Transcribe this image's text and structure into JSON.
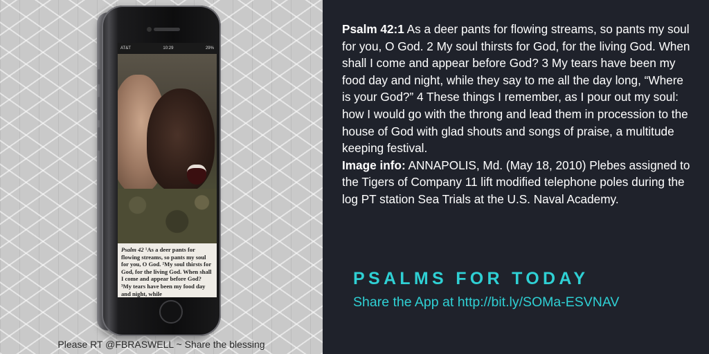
{
  "phone": {
    "carrier": "AT&T",
    "time": "10:29",
    "battery": "29%",
    "verse_ref": "Psalm 42",
    "verse_text": "¹As a deer pants for flowing streams, so pants my soul for you, O God. ²My soul thirsts for God, for the living God. When shall I come and appear before God? ³My tears have been my food day and night, while"
  },
  "left_caption": "Please RT @FBRASWELL ~ Share the blessing",
  "scripture": {
    "ref_label": "Psalm 42:1",
    "text": " As a deer pants for flowing streams, so pants my soul for you, O God. 2 My soul thirsts for God, for the living God. When shall I come and appear before God? 3 My tears have been my food day and night, while they say to me all the day long, “Where is your God?” 4 These things I remember, as I pour out my soul: how I would go with the throng and lead them in procession to the house of God with glad shouts and songs of praise, a multitude keeping festival.",
    "image_info_label": "Image info:",
    "image_info_text": " ANNAPOLIS, Md. (May 18, 2010) Plebes assigned to the Tigers of Company 11 lift modified telephone poles during the log PT station Sea Trials at the U.S. Naval Academy."
  },
  "brand": {
    "title": "PSALMS FOR TODAY",
    "share_text": "Share the App at  http://bit.ly/SOMa-ESVNAV",
    "accent_color": "#2fd0d4"
  }
}
